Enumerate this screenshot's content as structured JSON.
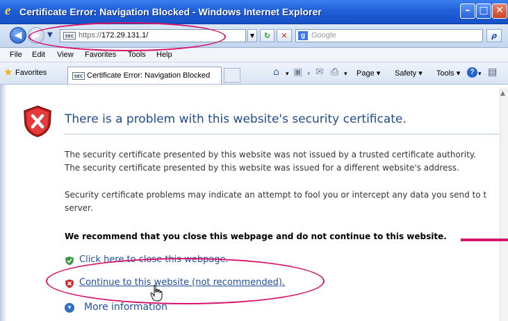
{
  "window": {
    "title": "Certificate Error: Navigation Blocked - Windows Internet Explorer",
    "minimize": "–",
    "maximize": "□",
    "close": "✕"
  },
  "address": {
    "cert_badge": "SEC",
    "url_scheme": "https://",
    "url_host": "172.29.131.1/",
    "search_placeholder": "Google",
    "search_button": "ρ"
  },
  "menu": [
    "File",
    "Edit",
    "View",
    "Favorites",
    "Tools",
    "Help"
  ],
  "toolbar": {
    "favorites": "Favorites",
    "tab_label": "Certificate Error: Navigation Blocked",
    "page": "Page ▾",
    "safety": "Safety ▾",
    "tools": "Tools ▾",
    "help": "?"
  },
  "page": {
    "heading": "There is a problem with this website's security certificate.",
    "p1": "The security certificate presented by this website was not issued by a trusted certificate authority.",
    "p2": "The security certificate presented by this website was issued for a different website's address.",
    "p3a": "Security certificate problems may indicate an attempt to fool you or intercept any data you send to t",
    "p3b": "server.",
    "recommend": "We recommend that you close this webpage and do not continue to this website.",
    "close_link": "Click here to close this webpage.",
    "continue_link": "Continue to this website (not recommended).",
    "more_info": "More information"
  },
  "colors": {
    "annotation": "#d6146b",
    "link": "#1f4e9c",
    "heading": "#1f4b8e"
  }
}
